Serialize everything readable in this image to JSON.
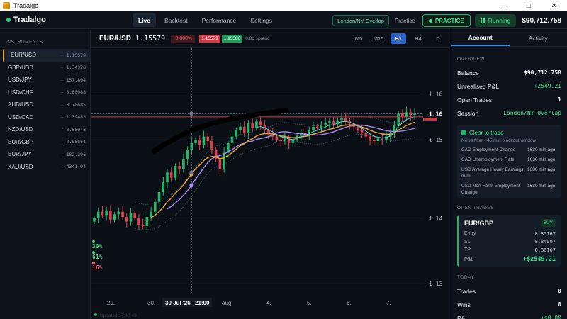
{
  "window": {
    "title": "Tradalgo",
    "controls": [
      "—",
      "□",
      "✕"
    ]
  },
  "brand": {
    "name": "Tradalgo"
  },
  "nav": {
    "tabs": [
      "Live",
      "Backtest",
      "Performance",
      "Settings"
    ],
    "active": "Live"
  },
  "header_right": {
    "session": "London/NY Overlap",
    "practice_label": "Practice",
    "practice_button": "PRACTICE",
    "running_button": "Running",
    "balance": "$90,712.758"
  },
  "sidebar": {
    "heading": "INSTRUMENTS",
    "items": [
      {
        "symbol": "EUR/USD",
        "price": "1.15579",
        "active": true
      },
      {
        "symbol": "GBP/USD",
        "price": "1.34928"
      },
      {
        "symbol": "USD/JPY",
        "price": "157.804"
      },
      {
        "symbol": "USD/CHF",
        "price": "0.80088"
      },
      {
        "symbol": "AUD/USD",
        "price": "0.70685"
      },
      {
        "symbol": "USD/CAD",
        "price": "1.39483"
      },
      {
        "symbol": "NZD/USD",
        "price": "0.58943"
      },
      {
        "symbol": "EUR/GBP",
        "price": "0.85661"
      },
      {
        "symbol": "EUR/JPY",
        "price": "182.396"
      },
      {
        "symbol": "XAU/USD",
        "price": "4341.94"
      }
    ]
  },
  "chart_header": {
    "pair": "EUR/USD",
    "price": "1.15579",
    "change": "-0.000%",
    "bid": "1.15579",
    "ask": "1.15586",
    "spread": "0.8p spread",
    "timeframes": [
      "M5",
      "M15",
      "H1",
      "H4",
      "D"
    ],
    "active_tf": "H1"
  },
  "chart_data": {
    "type": "candlestick",
    "instrument": "EUR/USD",
    "timeframe": "H1",
    "y_ticks": [
      "1.16",
      "1.16",
      "1.15",
      "1.14",
      "1.13"
    ],
    "y_tick_values": [
      1.162,
      1.159,
      1.155,
      1.143,
      1.133
    ],
    "ylim": [
      1.1315,
      1.169
    ],
    "x_ticks": [
      "29.",
      "30.",
      "30 Jul '26",
      "21:00",
      "Aug",
      "4.",
      "5.",
      "6.",
      "7."
    ],
    "x_labels_display": [
      "29.",
      "30.",
      "30 Jul '26",
      "21:00",
      "aug",
      "4.",
      "5.",
      "6.",
      "7."
    ],
    "current_price_label": "1.16",
    "current_price": 1.159,
    "resistance_level": 1.1585,
    "left_labels": [
      {
        "text": "30%",
        "color": "#3ee38a"
      },
      {
        "text": "61%",
        "color": "#3ee38a"
      },
      {
        "text": "16%",
        "color": "#ff5b6b"
      }
    ],
    "closes": [
      1.143,
      1.144,
      1.1435,
      1.1442,
      1.1428,
      1.1436,
      1.144,
      1.1432,
      1.1425,
      1.1438,
      1.143,
      1.142,
      1.1418,
      1.1432,
      1.144,
      1.1455,
      1.147,
      1.1485,
      1.15,
      1.1492,
      1.151,
      1.1505,
      1.152,
      1.1535,
      1.1545,
      1.155,
      1.1542,
      1.1555,
      1.1548,
      1.1535,
      1.152,
      1.1505,
      1.153,
      1.1545,
      1.1555,
      1.1565,
      1.157,
      1.156,
      1.1575,
      1.1568,
      1.1578,
      1.1572,
      1.1565,
      1.156,
      1.1555,
      1.155,
      1.1548,
      1.1552,
      1.1545,
      1.155,
      1.1556,
      1.156,
      1.1558,
      1.1565,
      1.157,
      1.1568,
      1.1572,
      1.1575,
      1.1578,
      1.1574,
      1.158,
      1.1583,
      1.1578,
      1.1575,
      1.157,
      1.1565,
      1.156,
      1.1555,
      1.155,
      1.1548,
      1.1552,
      1.155,
      1.1555,
      1.156,
      1.1572,
      1.159,
      1.1585,
      1.1592,
      1.1588,
      1.159
    ]
  },
  "footer": {
    "updated": "Updated 17:40:49"
  },
  "right_panel": {
    "tabs": [
      "Account",
      "Activity"
    ],
    "active_tab": "Account",
    "overview": {
      "heading": "OVERVIEW",
      "rows": [
        {
          "label": "Balance",
          "value": "$90,712.758",
          "style": ""
        },
        {
          "label": "Unrealised P&L",
          "value": "+2549.21",
          "style": "green"
        },
        {
          "label": "Open Trades",
          "value": "1",
          "style": ""
        },
        {
          "label": "Session",
          "value": "London/NY Overlap",
          "style": "teal"
        }
      ]
    },
    "clear_to_trade": {
      "title": "Clear to trade",
      "subtitle": "News filter · 45 min blackout window",
      "events": [
        {
          "name": "CAD Employment Change",
          "time": "1630 min ago"
        },
        {
          "name": "CAD Unemployment Rate",
          "time": "1630 min ago"
        },
        {
          "name": "USD Average Hourly Earnings m/m",
          "time": "1630 min ago"
        },
        {
          "name": "USD Non-Farm Employment Change",
          "time": "1630 min ago"
        }
      ]
    },
    "open_trades": {
      "heading": "OPEN TRADES",
      "trade": {
        "pair": "EUR/GBP",
        "side": "BUY",
        "entry_label": "Entry",
        "entry": "0.85167",
        "sl_label": "SL",
        "sl": "0.84907",
        "tp_label": "TP",
        "tp": "0.86167",
        "pnl_label": "P&L",
        "pnl": "+$2549.21"
      }
    },
    "today": {
      "heading": "TODAY",
      "rows": [
        {
          "label": "Trades",
          "value": "0"
        },
        {
          "label": "Wins",
          "value": "0"
        },
        {
          "label": "P&L",
          "value": "+$0.00"
        }
      ]
    }
  },
  "colors": {
    "accent_green": "#3ee38a",
    "accent_red": "#ff5b6b",
    "accent_blue": "#2d63c8",
    "active_instrument": "#e2a43b",
    "ema_fast": "#e8a33a",
    "ema_slow": "#a98cf0",
    "vwap": "#5bd0d0"
  }
}
